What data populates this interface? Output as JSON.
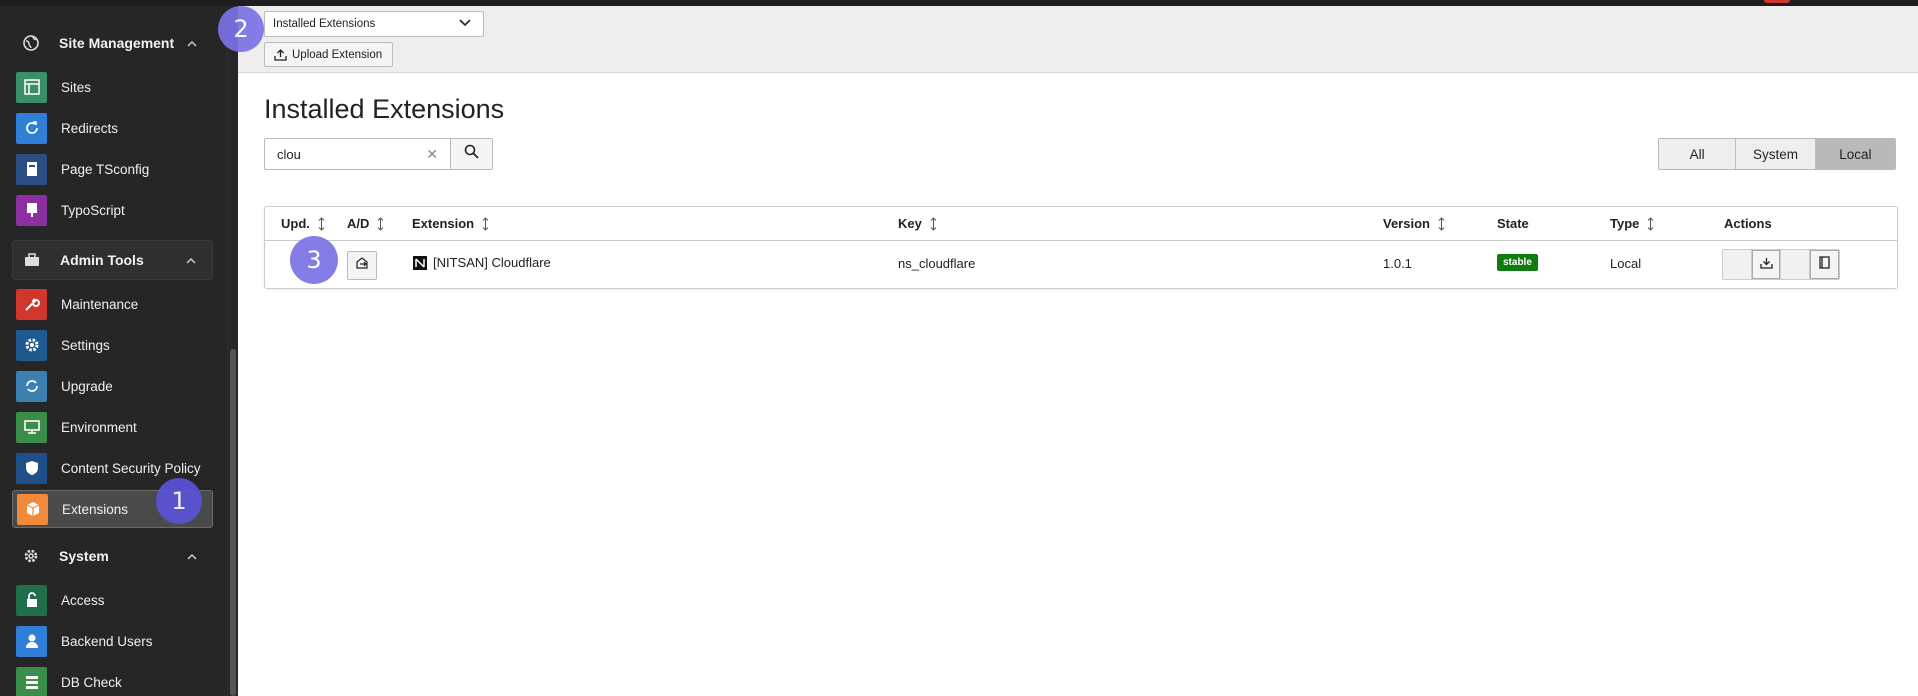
{
  "sidebar": {
    "groups": [
      {
        "label": "Site Management",
        "icon": "globe-icon"
      },
      {
        "label": "Admin Tools",
        "icon": "briefcase-icon"
      },
      {
        "label": "System",
        "icon": "gear-icon"
      }
    ],
    "items": [
      {
        "label": "Sites",
        "icon": "sites-icon",
        "color": "#3a8e6a"
      },
      {
        "label": "Redirects",
        "icon": "redirect-icon",
        "color": "#2f7fd8"
      },
      {
        "label": "Page TSconfig",
        "icon": "tsconfig-icon",
        "color": "#2b4f84"
      },
      {
        "label": "TypoScript",
        "icon": "typoscript-icon",
        "color": "#8c2fa0"
      },
      {
        "label": "Maintenance",
        "icon": "wrench-icon",
        "color": "#d0362c"
      },
      {
        "label": "Settings",
        "icon": "settings-icon",
        "color": "#1e5a8f"
      },
      {
        "label": "Upgrade",
        "icon": "upgrade-icon",
        "color": "#3c7fb1"
      },
      {
        "label": "Environment",
        "icon": "environment-icon",
        "color": "#3a8e4a"
      },
      {
        "label": "Content Security Policy",
        "icon": "shield-icon",
        "color": "#1f4f87"
      },
      {
        "label": "Extensions",
        "icon": "box-icon",
        "color": "#f08a3a"
      },
      {
        "label": "Access",
        "icon": "lock-icon",
        "color": "#1f6f4a"
      },
      {
        "label": "Backend Users",
        "icon": "user-icon",
        "color": "#2f7fd8"
      },
      {
        "label": "DB Check",
        "icon": "db-icon",
        "color": "#3a8e4a"
      }
    ]
  },
  "header": {
    "select_value": "Installed Extensions",
    "upload_label": "Upload Extension"
  },
  "main": {
    "title": "Installed Extensions",
    "search_value": "clou",
    "filters": [
      "All",
      "System",
      "Local"
    ],
    "active_filter": "Local"
  },
  "table": {
    "columns": [
      "Upd.",
      "A/D",
      "Extension",
      "Key",
      "Version",
      "State",
      "Type",
      "Actions"
    ],
    "rows": [
      {
        "extension": "[NITSAN] Cloudflare",
        "key": "ns_cloudflare",
        "version": "1.0.1",
        "state": "stable",
        "type": "Local"
      }
    ]
  },
  "markers": [
    "1",
    "2",
    "3"
  ],
  "colors": {
    "accent": "#5a54d8",
    "stable": "#107c10",
    "sidebar_bg": "#262626"
  }
}
